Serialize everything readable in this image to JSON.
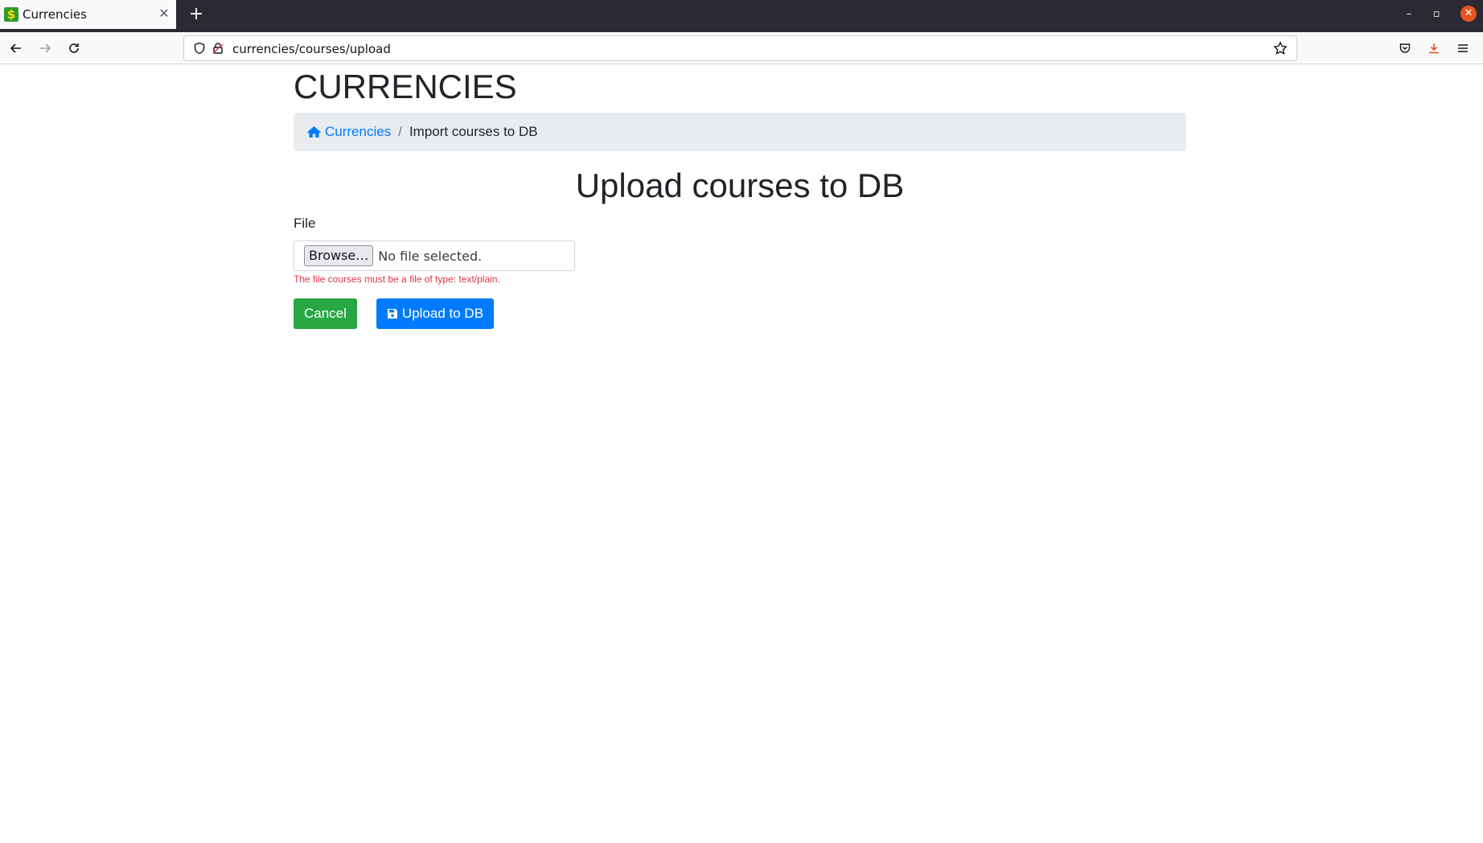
{
  "browser": {
    "tab_title": "Currencies",
    "tab_favicon_glyph": "$",
    "url": "currencies/courses/upload",
    "window_controls": {
      "minimize": "–",
      "restore": "▫",
      "close": "✕"
    },
    "tab_close": "✕",
    "new_tab": "+"
  },
  "page": {
    "site_title": "CURRENCIES",
    "breadcrumb": {
      "home_label": "Currencies",
      "separator": "/",
      "current": "Import courses to DB"
    },
    "heading": "Upload courses to DB",
    "form": {
      "file_label": "File",
      "browse_label": "Browse…",
      "no_file_text": "No file selected.",
      "error": "The file courses must be a file of type: text/plain.",
      "cancel_label": "Cancel",
      "upload_label": "Upload to DB"
    }
  },
  "colors": {
    "primary": "#007bff",
    "success": "#28a745",
    "danger": "#dc3545",
    "breadcrumb_bg": "#e9ecef",
    "titlebar_bg": "#2b2a33",
    "close_button": "#e95420"
  }
}
